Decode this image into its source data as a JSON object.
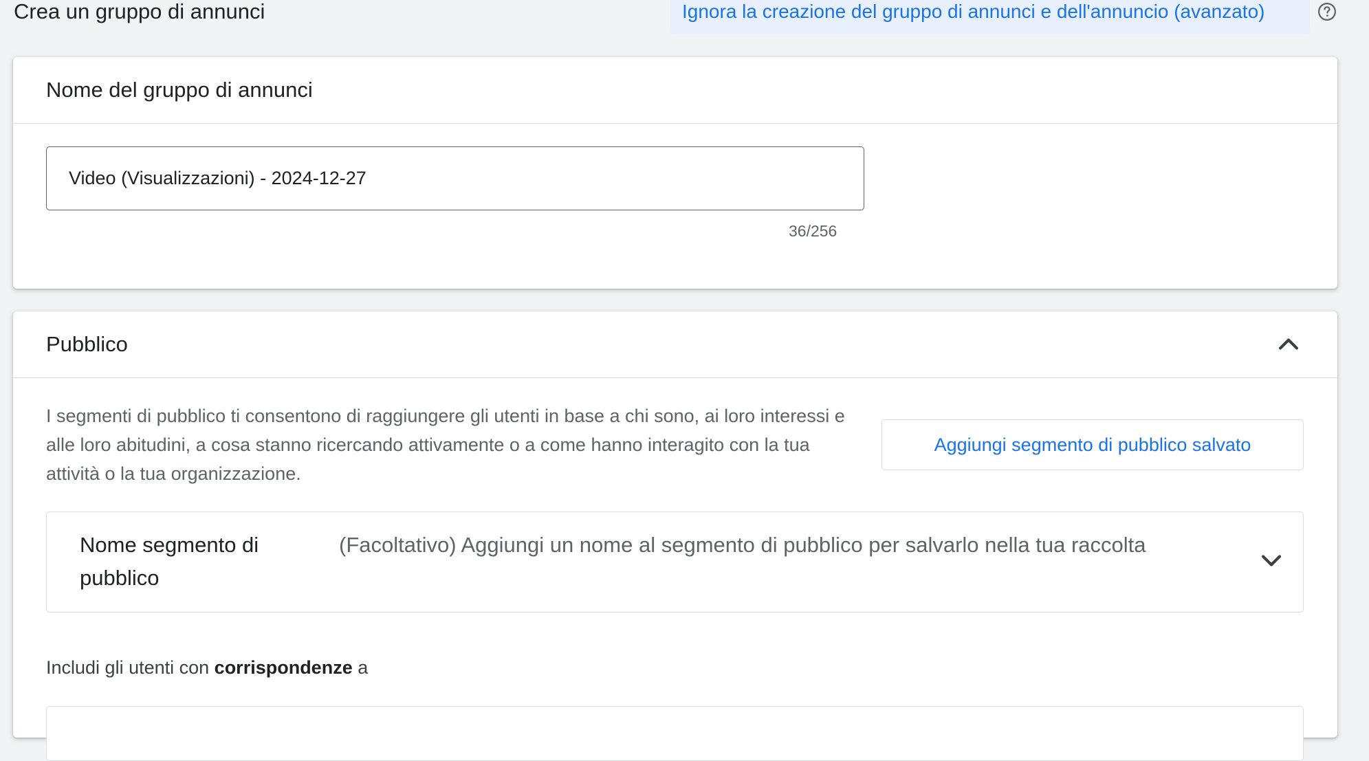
{
  "page_title": "Crea un gruppo di annunci",
  "skip_link": "Ignora la creazione del gruppo di annunci e dell'annuncio (avanzato)",
  "help_icon": "help-circle-icon",
  "ad_group_name": {
    "title": "Nome del gruppo di annunci",
    "value": "Video (Visualizzazioni) - 2024-12-27",
    "counter": "36/256"
  },
  "audience": {
    "title": "Pubblico",
    "collapse_icon": "chevron-up-icon",
    "description": "I segmenti di pubblico ti consentono di raggiungere gli utenti in base a chi sono, ai loro interessi e alle loro abitudini, a cosa stanno ricercando attivamente o a come hanno interagito con la tua attività o la tua organizzazione.",
    "add_saved_segment_label": "Aggiungi segmento di pubblico salvato",
    "segment_name_label": "Nome segmento di pubblico",
    "segment_name_hint": "(Facoltativo) Aggiungi un nome al segmento di pubblico per salvarlo nella tua raccolta",
    "expand_icon": "chevron-down-icon",
    "include_prefix": "Includi gli utenti con",
    "include_bold": "corrispondenze",
    "include_suffix": "a"
  },
  "colors": {
    "accent": "#1a73e8",
    "background": "#f1f3f4",
    "skip_bg": "#e8f0fe"
  }
}
